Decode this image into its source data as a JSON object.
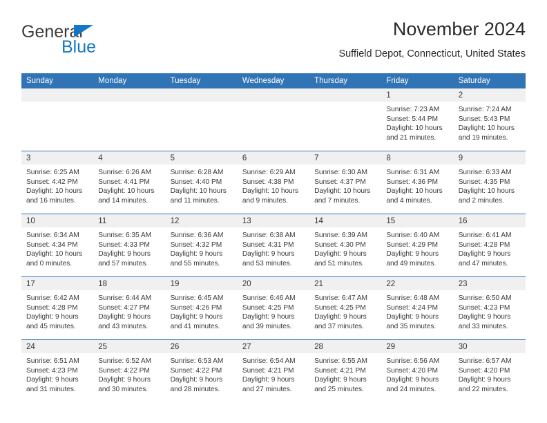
{
  "brand": {
    "name_top": "General",
    "name_bottom": "Blue",
    "triangle_color": "#1277c4",
    "text_color": "#3c3c3c"
  },
  "header": {
    "title": "November 2024",
    "subtitle": "Suffield Depot, Connecticut, United States"
  },
  "theme": {
    "header_blue": "#3174b5",
    "daynum_band": "#f0f0f0",
    "text": "#3a3a3a"
  },
  "calendar": {
    "weekday_headers": [
      "Sunday",
      "Monday",
      "Tuesday",
      "Wednesday",
      "Thursday",
      "Friday",
      "Saturday"
    ],
    "weeks": [
      [
        {
          "day": "",
          "sunrise": "",
          "sunset": "",
          "daylight_1": "",
          "daylight_2": ""
        },
        {
          "day": "",
          "sunrise": "",
          "sunset": "",
          "daylight_1": "",
          "daylight_2": ""
        },
        {
          "day": "",
          "sunrise": "",
          "sunset": "",
          "daylight_1": "",
          "daylight_2": ""
        },
        {
          "day": "",
          "sunrise": "",
          "sunset": "",
          "daylight_1": "",
          "daylight_2": ""
        },
        {
          "day": "",
          "sunrise": "",
          "sunset": "",
          "daylight_1": "",
          "daylight_2": ""
        },
        {
          "day": "1",
          "sunrise": "Sunrise: 7:23 AM",
          "sunset": "Sunset: 5:44 PM",
          "daylight_1": "Daylight: 10 hours",
          "daylight_2": "and 21 minutes."
        },
        {
          "day": "2",
          "sunrise": "Sunrise: 7:24 AM",
          "sunset": "Sunset: 5:43 PM",
          "daylight_1": "Daylight: 10 hours",
          "daylight_2": "and 19 minutes."
        }
      ],
      [
        {
          "day": "3",
          "sunrise": "Sunrise: 6:25 AM",
          "sunset": "Sunset: 4:42 PM",
          "daylight_1": "Daylight: 10 hours",
          "daylight_2": "and 16 minutes."
        },
        {
          "day": "4",
          "sunrise": "Sunrise: 6:26 AM",
          "sunset": "Sunset: 4:41 PM",
          "daylight_1": "Daylight: 10 hours",
          "daylight_2": "and 14 minutes."
        },
        {
          "day": "5",
          "sunrise": "Sunrise: 6:28 AM",
          "sunset": "Sunset: 4:40 PM",
          "daylight_1": "Daylight: 10 hours",
          "daylight_2": "and 11 minutes."
        },
        {
          "day": "6",
          "sunrise": "Sunrise: 6:29 AM",
          "sunset": "Sunset: 4:38 PM",
          "daylight_1": "Daylight: 10 hours",
          "daylight_2": "and 9 minutes."
        },
        {
          "day": "7",
          "sunrise": "Sunrise: 6:30 AM",
          "sunset": "Sunset: 4:37 PM",
          "daylight_1": "Daylight: 10 hours",
          "daylight_2": "and 7 minutes."
        },
        {
          "day": "8",
          "sunrise": "Sunrise: 6:31 AM",
          "sunset": "Sunset: 4:36 PM",
          "daylight_1": "Daylight: 10 hours",
          "daylight_2": "and 4 minutes."
        },
        {
          "day": "9",
          "sunrise": "Sunrise: 6:33 AM",
          "sunset": "Sunset: 4:35 PM",
          "daylight_1": "Daylight: 10 hours",
          "daylight_2": "and 2 minutes."
        }
      ],
      [
        {
          "day": "10",
          "sunrise": "Sunrise: 6:34 AM",
          "sunset": "Sunset: 4:34 PM",
          "daylight_1": "Daylight: 10 hours",
          "daylight_2": "and 0 minutes."
        },
        {
          "day": "11",
          "sunrise": "Sunrise: 6:35 AM",
          "sunset": "Sunset: 4:33 PM",
          "daylight_1": "Daylight: 9 hours",
          "daylight_2": "and 57 minutes."
        },
        {
          "day": "12",
          "sunrise": "Sunrise: 6:36 AM",
          "sunset": "Sunset: 4:32 PM",
          "daylight_1": "Daylight: 9 hours",
          "daylight_2": "and 55 minutes."
        },
        {
          "day": "13",
          "sunrise": "Sunrise: 6:38 AM",
          "sunset": "Sunset: 4:31 PM",
          "daylight_1": "Daylight: 9 hours",
          "daylight_2": "and 53 minutes."
        },
        {
          "day": "14",
          "sunrise": "Sunrise: 6:39 AM",
          "sunset": "Sunset: 4:30 PM",
          "daylight_1": "Daylight: 9 hours",
          "daylight_2": "and 51 minutes."
        },
        {
          "day": "15",
          "sunrise": "Sunrise: 6:40 AM",
          "sunset": "Sunset: 4:29 PM",
          "daylight_1": "Daylight: 9 hours",
          "daylight_2": "and 49 minutes."
        },
        {
          "day": "16",
          "sunrise": "Sunrise: 6:41 AM",
          "sunset": "Sunset: 4:28 PM",
          "daylight_1": "Daylight: 9 hours",
          "daylight_2": "and 47 minutes."
        }
      ],
      [
        {
          "day": "17",
          "sunrise": "Sunrise: 6:42 AM",
          "sunset": "Sunset: 4:28 PM",
          "daylight_1": "Daylight: 9 hours",
          "daylight_2": "and 45 minutes."
        },
        {
          "day": "18",
          "sunrise": "Sunrise: 6:44 AM",
          "sunset": "Sunset: 4:27 PM",
          "daylight_1": "Daylight: 9 hours",
          "daylight_2": "and 43 minutes."
        },
        {
          "day": "19",
          "sunrise": "Sunrise: 6:45 AM",
          "sunset": "Sunset: 4:26 PM",
          "daylight_1": "Daylight: 9 hours",
          "daylight_2": "and 41 minutes."
        },
        {
          "day": "20",
          "sunrise": "Sunrise: 6:46 AM",
          "sunset": "Sunset: 4:25 PM",
          "daylight_1": "Daylight: 9 hours",
          "daylight_2": "and 39 minutes."
        },
        {
          "day": "21",
          "sunrise": "Sunrise: 6:47 AM",
          "sunset": "Sunset: 4:25 PM",
          "daylight_1": "Daylight: 9 hours",
          "daylight_2": "and 37 minutes."
        },
        {
          "day": "22",
          "sunrise": "Sunrise: 6:48 AM",
          "sunset": "Sunset: 4:24 PM",
          "daylight_1": "Daylight: 9 hours",
          "daylight_2": "and 35 minutes."
        },
        {
          "day": "23",
          "sunrise": "Sunrise: 6:50 AM",
          "sunset": "Sunset: 4:23 PM",
          "daylight_1": "Daylight: 9 hours",
          "daylight_2": "and 33 minutes."
        }
      ],
      [
        {
          "day": "24",
          "sunrise": "Sunrise: 6:51 AM",
          "sunset": "Sunset: 4:23 PM",
          "daylight_1": "Daylight: 9 hours",
          "daylight_2": "and 31 minutes."
        },
        {
          "day": "25",
          "sunrise": "Sunrise: 6:52 AM",
          "sunset": "Sunset: 4:22 PM",
          "daylight_1": "Daylight: 9 hours",
          "daylight_2": "and 30 minutes."
        },
        {
          "day": "26",
          "sunrise": "Sunrise: 6:53 AM",
          "sunset": "Sunset: 4:22 PM",
          "daylight_1": "Daylight: 9 hours",
          "daylight_2": "and 28 minutes."
        },
        {
          "day": "27",
          "sunrise": "Sunrise: 6:54 AM",
          "sunset": "Sunset: 4:21 PM",
          "daylight_1": "Daylight: 9 hours",
          "daylight_2": "and 27 minutes."
        },
        {
          "day": "28",
          "sunrise": "Sunrise: 6:55 AM",
          "sunset": "Sunset: 4:21 PM",
          "daylight_1": "Daylight: 9 hours",
          "daylight_2": "and 25 minutes."
        },
        {
          "day": "29",
          "sunrise": "Sunrise: 6:56 AM",
          "sunset": "Sunset: 4:20 PM",
          "daylight_1": "Daylight: 9 hours",
          "daylight_2": "and 24 minutes."
        },
        {
          "day": "30",
          "sunrise": "Sunrise: 6:57 AM",
          "sunset": "Sunset: 4:20 PM",
          "daylight_1": "Daylight: 9 hours",
          "daylight_2": "and 22 minutes."
        }
      ]
    ]
  }
}
